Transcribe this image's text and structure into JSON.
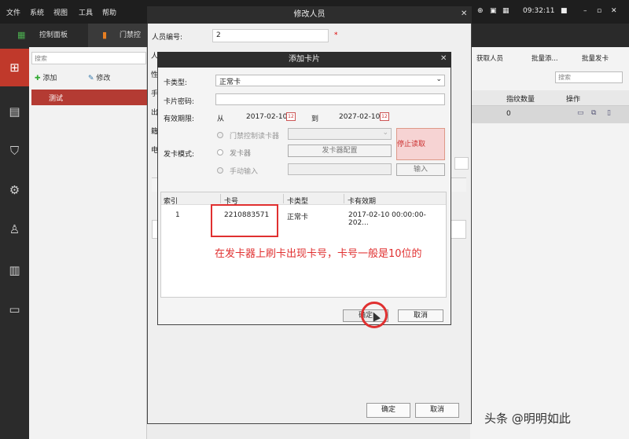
{
  "menubar": {
    "items": [
      "文件",
      "系统",
      "视图",
      "工具",
      "帮助"
    ],
    "user": "in",
    "time": "09:32:11"
  },
  "tabs": [
    {
      "label": "控制面板"
    },
    {
      "label": "门禁控"
    }
  ],
  "left_panel": {
    "search_placeholder": "搜索",
    "add_label": "添加",
    "edit_label": "修改",
    "org_name": "测试"
  },
  "right_panel": {
    "get_person": "获取人员",
    "batch_add": "批量添...",
    "batch_card": "批量发卡",
    "search_placeholder": "搜索",
    "col_fingerprint": "指纹数量",
    "col_ops": "操作",
    "row_fingerprint_count": "0"
  },
  "outer_dialog": {
    "title": "修改人员",
    "person_id_label": "人员编号:",
    "person_id_value": "2",
    "cut_labels": [
      "人",
      "性",
      "手",
      "出",
      "籍",
      "电"
    ],
    "confirm": "确定",
    "cancel": "取消"
  },
  "inner_dialog": {
    "title": "添加卡片",
    "card_type_label": "卡类型:",
    "card_type_value": "正常卡",
    "card_pwd_label": "卡片密码:",
    "valid_label": "有效期限:",
    "from_label": "从",
    "from_date": "2017-02-10",
    "to_label": "到",
    "to_date": "2027-02-10",
    "issue_mode_label": "发卡模式:",
    "opt_reader": "门禁控制读卡器",
    "opt_issuer": "发卡器",
    "issuer_config": "发卡器配置",
    "opt_manual": "手动输入",
    "manual_input_btn": "输入",
    "stop_read": "停止读取",
    "table": {
      "columns": [
        "索引",
        "卡号",
        "卡类型",
        "卡有效期"
      ],
      "rows": [
        {
          "index": "1",
          "card_no": "2210883571",
          "type": "正常卡",
          "validity": "2017-02-10 00:00:00-202..."
        }
      ]
    },
    "annotation": "在发卡器上刷卡出现卡号，卡号一般是10位的",
    "confirm": "确定",
    "cancel": "取消"
  },
  "watermark": "头条 @明明如此",
  "colors": {
    "accent": "#c0392b",
    "annotation": "#e03030"
  }
}
